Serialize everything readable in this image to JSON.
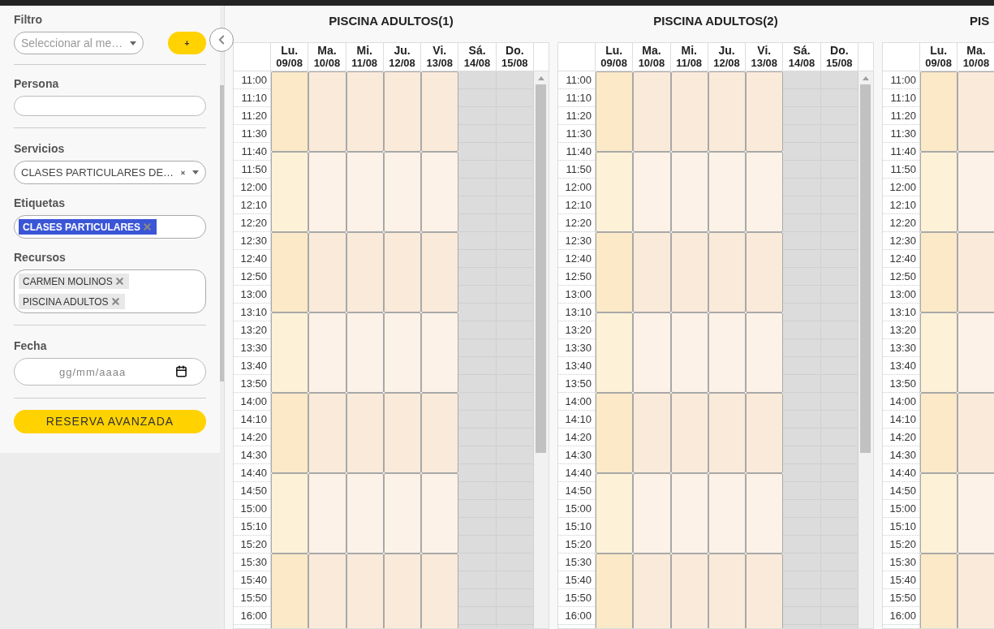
{
  "sidebar": {
    "filter": {
      "label": "Filtro",
      "placeholder": "Seleccionar al me…",
      "add_button": "+"
    },
    "person": {
      "label": "Persona"
    },
    "services": {
      "label": "Servicios",
      "value": "CLASES PARTICULARES DE…"
    },
    "tags": {
      "label": "Etiquetas",
      "chips": [
        "CLASES PARTICULARES"
      ]
    },
    "resources": {
      "label": "Recursos",
      "chips": [
        "CARMEN MOLINOS",
        "PISCINA ADULTOS"
      ]
    },
    "date": {
      "label": "Fecha",
      "placeholder": "gg/mm/aaaa"
    },
    "advanced_button": "RESERVA AVANZADA"
  },
  "calendars": [
    {
      "title": "PISCINA ADULTOS(1)",
      "cut_off": false,
      "days": [
        {
          "label": "Lu.",
          "date": "09/08",
          "today": true,
          "open": true
        },
        {
          "label": "Ma.",
          "date": "10/08",
          "today": false,
          "open": true
        },
        {
          "label": "Mi.",
          "date": "11/08",
          "today": false,
          "open": true
        },
        {
          "label": "Ju.",
          "date": "12/08",
          "today": false,
          "open": true
        },
        {
          "label": "Vi.",
          "date": "13/08",
          "today": false,
          "open": true
        },
        {
          "label": "Sá.",
          "date": "14/08",
          "today": false,
          "open": false
        },
        {
          "label": "Do.",
          "date": "15/08",
          "today": false,
          "open": false
        }
      ],
      "times": [
        "11:00",
        "11:10",
        "11:20",
        "11:30",
        "11:40",
        "11:50",
        "12:00",
        "12:10",
        "12:20",
        "12:30",
        "12:40",
        "12:50",
        "13:00",
        "13:10",
        "13:20",
        "13:30",
        "13:40",
        "13:50",
        "14:00",
        "14:10",
        "14:20",
        "14:30",
        "14:40",
        "14:50",
        "15:00",
        "15:10",
        "15:20",
        "15:30",
        "15:40",
        "15:50",
        "16:00"
      ]
    },
    {
      "title": "PISCINA ADULTOS(2)",
      "cut_off": false,
      "days": [
        {
          "label": "Lu.",
          "date": "09/08",
          "today": true,
          "open": true
        },
        {
          "label": "Ma.",
          "date": "10/08",
          "today": false,
          "open": true
        },
        {
          "label": "Mi.",
          "date": "11/08",
          "today": false,
          "open": true
        },
        {
          "label": "Ju.",
          "date": "12/08",
          "today": false,
          "open": true
        },
        {
          "label": "Vi.",
          "date": "13/08",
          "today": false,
          "open": true
        },
        {
          "label": "Sá.",
          "date": "14/08",
          "today": false,
          "open": false
        },
        {
          "label": "Do.",
          "date": "15/08",
          "today": false,
          "open": false
        }
      ],
      "times": [
        "11:00",
        "11:10",
        "11:20",
        "11:30",
        "11:40",
        "11:50",
        "12:00",
        "12:10",
        "12:20",
        "12:30",
        "12:40",
        "12:50",
        "13:00",
        "13:10",
        "13:20",
        "13:30",
        "13:40",
        "13:50",
        "14:00",
        "14:10",
        "14:20",
        "14:30",
        "14:40",
        "14:50",
        "15:00",
        "15:10",
        "15:20",
        "15:30",
        "15:40",
        "15:50",
        "16:00"
      ]
    },
    {
      "title": "PIS",
      "cut_off": true,
      "days": [
        {
          "label": "Lu.",
          "date": "09/08",
          "today": true,
          "open": true
        },
        {
          "label": "Ma.",
          "date": "10/08",
          "today": false,
          "open": true
        }
      ],
      "times": [
        "11:00",
        "11:10",
        "11:20",
        "11:30",
        "11:40",
        "11:50",
        "12:00",
        "12:10",
        "12:20",
        "12:30",
        "12:40",
        "12:50",
        "13:00",
        "13:10",
        "13:20",
        "13:30",
        "13:40",
        "13:50",
        "14:00",
        "14:10",
        "14:20",
        "14:30",
        "14:40",
        "14:50",
        "15:00",
        "15:10",
        "15:20",
        "15:30",
        "15:40",
        "15:50",
        "16:00"
      ]
    }
  ]
}
